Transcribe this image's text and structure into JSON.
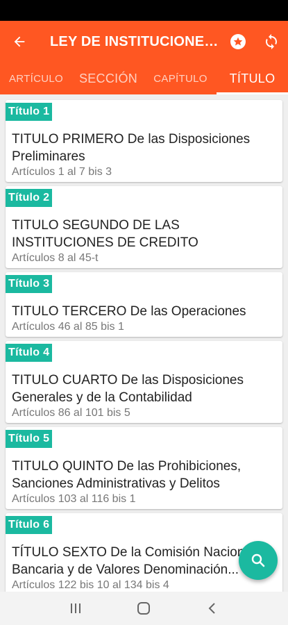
{
  "app_bar": {
    "title": "LEY DE INSTITUCIONES...",
    "back_icon": "arrow-back-icon",
    "favorite_icon": "star-circle-icon",
    "sync_icon": "sync-icon"
  },
  "tabs": [
    {
      "label": "ARTÍCULO",
      "active": false
    },
    {
      "label": "SECCIÓN",
      "active": false
    },
    {
      "label": "CAPÍTULO",
      "active": false
    },
    {
      "label": "TÍTULO",
      "active": true
    }
  ],
  "items": [
    {
      "badge": "Título  1",
      "title": "TITULO PRIMERO De las Disposiciones Preliminares",
      "range": "Artículos 1 al 7 bis 3"
    },
    {
      "badge": "Título  2",
      "title": "TITULO SEGUNDO DE LAS INSTITUCIONES DE CREDITO",
      "range": "Artículos 8 al 45-t"
    },
    {
      "badge": "Título  3",
      "title": "TITULO TERCERO De las Operaciones",
      "range": "Artículos 46 al 85 bis 1"
    },
    {
      "badge": "Título  4",
      "title": "TITULO CUARTO De las Disposiciones Generales y de la Contabilidad",
      "range": "Artículos 86 al 101 bis 5"
    },
    {
      "badge": "Título  5",
      "title": "TITULO QUINTO De las Prohibiciones, Sanciones Administrativas y Delitos",
      "range": "Artículos 103 al 116 bis 1"
    },
    {
      "badge": "Título  6",
      "title": "TÍTULO SEXTO De la Comisión Nacional Bancaria y de Valores Denominación...",
      "range": "Artículos 122 bis 10 al 134 bis 4"
    }
  ],
  "fab": {
    "icon": "search-icon"
  },
  "nav": {
    "recents_icon": "recents-icon",
    "home_icon": "home-icon",
    "back_icon": "nav-back-icon"
  },
  "colors": {
    "primary": "#ff5722",
    "accent": "#1bb9a0"
  }
}
